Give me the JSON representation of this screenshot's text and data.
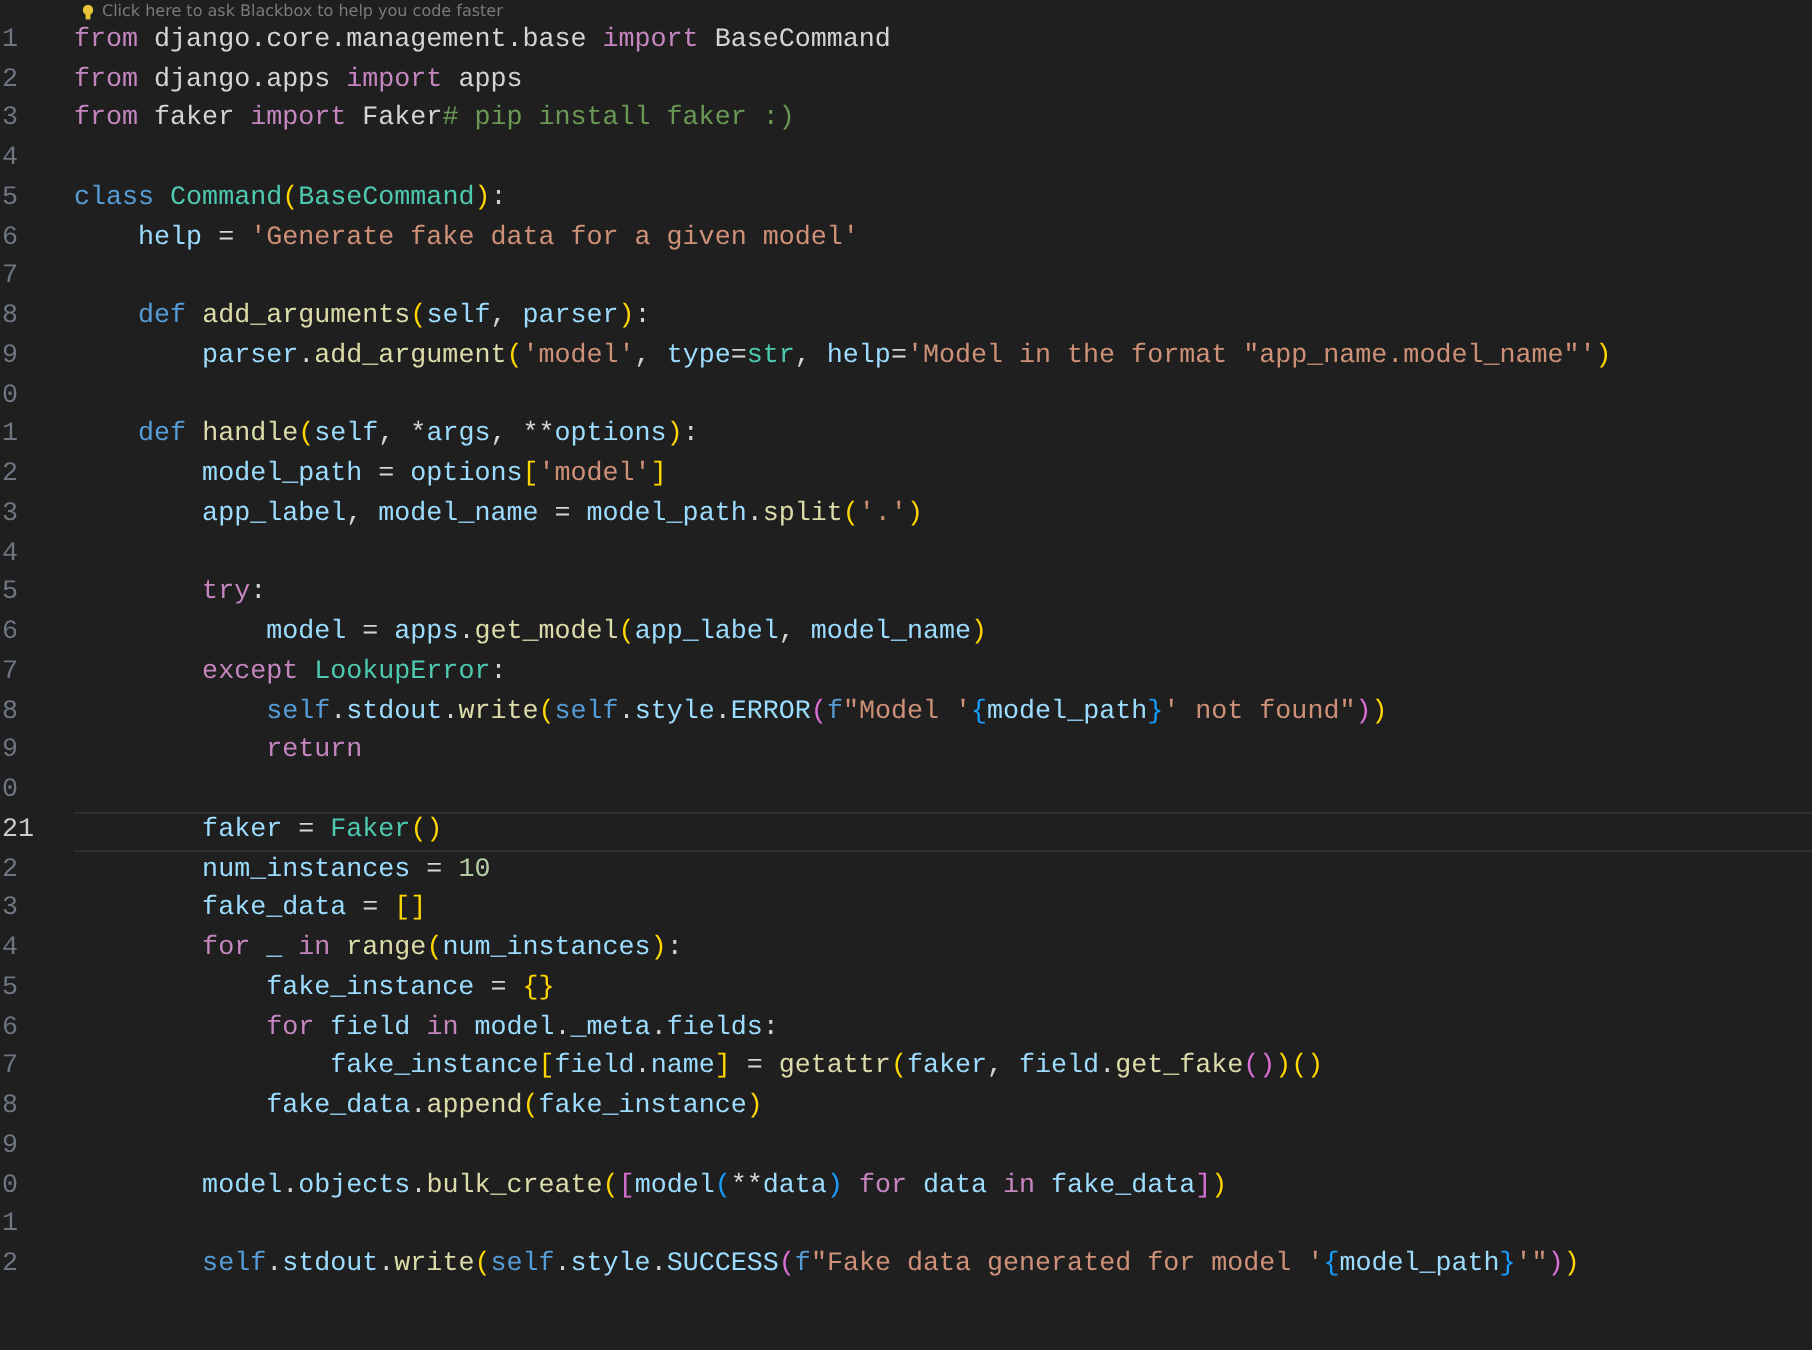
{
  "hint": {
    "text": "Click here to ask Blackbox to help you code faster"
  },
  "lines": [
    {
      "number": "1",
      "active": false,
      "tokens": [
        {
          "text": "from",
          "kind": "k"
        },
        {
          "text": " django.core.management.base ",
          "kind": "op"
        },
        {
          "text": "import",
          "kind": "k"
        },
        {
          "text": " BaseCommand",
          "kind": "op"
        }
      ]
    },
    {
      "number": "2",
      "active": false,
      "tokens": [
        {
          "text": "from",
          "kind": "k"
        },
        {
          "text": " django.apps ",
          "kind": "op"
        },
        {
          "text": "import",
          "kind": "k"
        },
        {
          "text": " apps",
          "kind": "op"
        }
      ]
    },
    {
      "number": "3",
      "active": false,
      "tokens": [
        {
          "text": "from",
          "kind": "k"
        },
        {
          "text": " faker ",
          "kind": "op"
        },
        {
          "text": "import",
          "kind": "k"
        },
        {
          "text": " Faker",
          "kind": "op"
        },
        {
          "text": "# pip install faker :)",
          "kind": "cm"
        }
      ]
    },
    {
      "number": "4",
      "active": false
    },
    {
      "number": "5",
      "active": false,
      "tokens": [
        {
          "text": "class ",
          "kind": "s"
        },
        {
          "text": "Command",
          "kind": "cls"
        },
        {
          "text": "(",
          "kind": "b1"
        },
        {
          "text": "BaseCommand",
          "kind": "cls"
        },
        {
          "text": ")",
          "kind": "b1"
        },
        {
          "text": ":",
          "kind": "op"
        }
      ]
    },
    {
      "number": "6",
      "active": false,
      "tokens": [
        {
          "text": "    help",
          "kind": "var"
        },
        {
          "text": " = ",
          "kind": "op"
        },
        {
          "text": "'Generate fake data for a given model'",
          "kind": "str"
        }
      ]
    },
    {
      "number": "7",
      "active": false
    },
    {
      "number": "8",
      "active": false,
      "tokens": [
        {
          "text": "    def ",
          "kind": "s"
        },
        {
          "text": "add_arguments",
          "kind": "fn"
        },
        {
          "text": "(",
          "kind": "b1"
        },
        {
          "text": "self",
          "kind": "var"
        },
        {
          "text": ", ",
          "kind": "op"
        },
        {
          "text": "parser",
          "kind": "var"
        },
        {
          "text": ")",
          "kind": "b1"
        },
        {
          "text": ":",
          "kind": "op"
        }
      ]
    },
    {
      "number": "9",
      "active": false,
      "tokens": [
        {
          "text": "        parser",
          "kind": "var"
        },
        {
          "text": ".",
          "kind": "op"
        },
        {
          "text": "add_argument",
          "kind": "fn"
        },
        {
          "text": "(",
          "kind": "b1"
        },
        {
          "text": "'model'",
          "kind": "str"
        },
        {
          "text": ", ",
          "kind": "op"
        },
        {
          "text": "type",
          "kind": "var"
        },
        {
          "text": "=",
          "kind": "op"
        },
        {
          "text": "str",
          "kind": "cls"
        },
        {
          "text": ", ",
          "kind": "op"
        },
        {
          "text": "help",
          "kind": "var"
        },
        {
          "text": "=",
          "kind": "op"
        },
        {
          "text": "'Model in the format \"app_name.model_name\"'",
          "kind": "str"
        },
        {
          "text": ")",
          "kind": "b1"
        }
      ]
    },
    {
      "number": "0",
      "active": false
    },
    {
      "number": "1",
      "active": false,
      "tokens": [
        {
          "text": "    def ",
          "kind": "s"
        },
        {
          "text": "handle",
          "kind": "fn"
        },
        {
          "text": "(",
          "kind": "b1"
        },
        {
          "text": "self",
          "kind": "var"
        },
        {
          "text": ", *",
          "kind": "op"
        },
        {
          "text": "args",
          "kind": "var"
        },
        {
          "text": ", **",
          "kind": "op"
        },
        {
          "text": "options",
          "kind": "var"
        },
        {
          "text": ")",
          "kind": "b1"
        },
        {
          "text": ":",
          "kind": "op"
        }
      ]
    },
    {
      "number": "2",
      "active": false,
      "tokens": [
        {
          "text": "        model_path",
          "kind": "var"
        },
        {
          "text": " = ",
          "kind": "op"
        },
        {
          "text": "options",
          "kind": "var"
        },
        {
          "text": "[",
          "kind": "b1"
        },
        {
          "text": "'model'",
          "kind": "str"
        },
        {
          "text": "]",
          "kind": "b1"
        }
      ]
    },
    {
      "number": "3",
      "active": false,
      "tokens": [
        {
          "text": "        app_label",
          "kind": "var"
        },
        {
          "text": ", ",
          "kind": "op"
        },
        {
          "text": "model_name",
          "kind": "var"
        },
        {
          "text": " = ",
          "kind": "op"
        },
        {
          "text": "model_path",
          "kind": "var"
        },
        {
          "text": ".",
          "kind": "op"
        },
        {
          "text": "split",
          "kind": "fn"
        },
        {
          "text": "(",
          "kind": "b1"
        },
        {
          "text": "'.'",
          "kind": "str"
        },
        {
          "text": ")",
          "kind": "b1"
        }
      ]
    },
    {
      "number": "4",
      "active": false
    },
    {
      "number": "5",
      "active": false,
      "tokens": [
        {
          "text": "        try",
          "kind": "k"
        },
        {
          "text": ":",
          "kind": "op"
        }
      ]
    },
    {
      "number": "6",
      "active": false,
      "tokens": [
        {
          "text": "            model",
          "kind": "var"
        },
        {
          "text": " = ",
          "kind": "op"
        },
        {
          "text": "apps",
          "kind": "var"
        },
        {
          "text": ".",
          "kind": "op"
        },
        {
          "text": "get_model",
          "kind": "fn"
        },
        {
          "text": "(",
          "kind": "b1"
        },
        {
          "text": "app_label",
          "kind": "var"
        },
        {
          "text": ", ",
          "kind": "op"
        },
        {
          "text": "model_name",
          "kind": "var"
        },
        {
          "text": ")",
          "kind": "b1"
        }
      ]
    },
    {
      "number": "7",
      "active": false,
      "tokens": [
        {
          "text": "        except ",
          "kind": "k"
        },
        {
          "text": "LookupError",
          "kind": "cls"
        },
        {
          "text": ":",
          "kind": "op"
        }
      ]
    },
    {
      "number": "8",
      "active": false,
      "tokens": [
        {
          "text": "            self",
          "kind": "s"
        },
        {
          "text": ".",
          "kind": "op"
        },
        {
          "text": "stdout",
          "kind": "var"
        },
        {
          "text": ".",
          "kind": "op"
        },
        {
          "text": "write",
          "kind": "fn"
        },
        {
          "text": "(",
          "kind": "b1"
        },
        {
          "text": "self",
          "kind": "s"
        },
        {
          "text": ".",
          "kind": "op"
        },
        {
          "text": "style",
          "kind": "var"
        },
        {
          "text": ".",
          "kind": "op"
        },
        {
          "text": "ERROR",
          "kind": "var"
        },
        {
          "text": "(",
          "kind": "b2"
        },
        {
          "text": "f",
          "kind": "s"
        },
        {
          "text": "\"Model '",
          "kind": "str"
        },
        {
          "text": "{",
          "kind": "b3"
        },
        {
          "text": "model_path",
          "kind": "var"
        },
        {
          "text": "}",
          "kind": "b3"
        },
        {
          "text": "' not found\"",
          "kind": "str"
        },
        {
          "text": ")",
          "kind": "b2"
        },
        {
          "text": ")",
          "kind": "b1"
        }
      ]
    },
    {
      "number": "9",
      "active": false,
      "tokens": [
        {
          "text": "            return",
          "kind": "k"
        }
      ]
    },
    {
      "number": "0",
      "active": false
    },
    {
      "number": "21",
      "active": true,
      "tokens": [
        {
          "text": "        faker",
          "kind": "var"
        },
        {
          "text": " = ",
          "kind": "op"
        },
        {
          "text": "Faker",
          "kind": "cls"
        },
        {
          "text": "()",
          "kind": "b1"
        }
      ]
    },
    {
      "number": "2",
      "active": false,
      "tokens": [
        {
          "text": "        num_instances",
          "kind": "var"
        },
        {
          "text": " = ",
          "kind": "op"
        },
        {
          "text": "10",
          "kind": "num"
        }
      ]
    },
    {
      "number": "3",
      "active": false,
      "tokens": [
        {
          "text": "        fake_data",
          "kind": "var"
        },
        {
          "text": " = ",
          "kind": "op"
        },
        {
          "text": "[]",
          "kind": "b1"
        }
      ]
    },
    {
      "number": "4",
      "active": false,
      "tokens": [
        {
          "text": "        for",
          "kind": "k"
        },
        {
          "text": " _ ",
          "kind": "var"
        },
        {
          "text": "in ",
          "kind": "k"
        },
        {
          "text": "range",
          "kind": "fn"
        },
        {
          "text": "(",
          "kind": "b1"
        },
        {
          "text": "num_instances",
          "kind": "var"
        },
        {
          "text": ")",
          "kind": "b1"
        },
        {
          "text": ":",
          "kind": "op"
        }
      ]
    },
    {
      "number": "5",
      "active": false,
      "tokens": [
        {
          "text": "            fake_instance",
          "kind": "var"
        },
        {
          "text": " = ",
          "kind": "op"
        },
        {
          "text": "{}",
          "kind": "b1"
        }
      ]
    },
    {
      "number": "6",
      "active": false,
      "tokens": [
        {
          "text": "            for",
          "kind": "k"
        },
        {
          "text": " field ",
          "kind": "var"
        },
        {
          "text": "in",
          "kind": "k"
        },
        {
          "text": " model",
          "kind": "var"
        },
        {
          "text": ".",
          "kind": "op"
        },
        {
          "text": "_meta",
          "kind": "var"
        },
        {
          "text": ".",
          "kind": "op"
        },
        {
          "text": "fields",
          "kind": "var"
        },
        {
          "text": ":",
          "kind": "op"
        }
      ]
    },
    {
      "number": "7",
      "active": false,
      "tokens": [
        {
          "text": "                fake_instance",
          "kind": "var"
        },
        {
          "text": "[",
          "kind": "b1"
        },
        {
          "text": "field",
          "kind": "var"
        },
        {
          "text": ".",
          "kind": "op"
        },
        {
          "text": "name",
          "kind": "var"
        },
        {
          "text": "]",
          "kind": "b1"
        },
        {
          "text": " = ",
          "kind": "op"
        },
        {
          "text": "getattr",
          "kind": "fn"
        },
        {
          "text": "(",
          "kind": "b1"
        },
        {
          "text": "faker",
          "kind": "var"
        },
        {
          "text": ", ",
          "kind": "op"
        },
        {
          "text": "field",
          "kind": "var"
        },
        {
          "text": ".",
          "kind": "op"
        },
        {
          "text": "get_fake",
          "kind": "fn"
        },
        {
          "text": "()",
          "kind": "b2"
        },
        {
          "text": ")()",
          "kind": "b1"
        }
      ]
    },
    {
      "number": "8",
      "active": false,
      "tokens": [
        {
          "text": "            fake_data",
          "kind": "var"
        },
        {
          "text": ".",
          "kind": "op"
        },
        {
          "text": "append",
          "kind": "fn"
        },
        {
          "text": "(",
          "kind": "b1"
        },
        {
          "text": "fake_instance",
          "kind": "var"
        },
        {
          "text": ")",
          "kind": "b1"
        }
      ]
    },
    {
      "number": "9",
      "active": false
    },
    {
      "number": "0",
      "active": false,
      "tokens": [
        {
          "text": "        model",
          "kind": "var"
        },
        {
          "text": ".",
          "kind": "op"
        },
        {
          "text": "objects",
          "kind": "var"
        },
        {
          "text": ".",
          "kind": "op"
        },
        {
          "text": "bulk_create",
          "kind": "fn"
        },
        {
          "text": "(",
          "kind": "b1"
        },
        {
          "text": "[",
          "kind": "b2"
        },
        {
          "text": "model",
          "kind": "var"
        },
        {
          "text": "(",
          "kind": "b3"
        },
        {
          "text": "**",
          "kind": "op"
        },
        {
          "text": "data",
          "kind": "var"
        },
        {
          "text": ")",
          "kind": "b3"
        },
        {
          "text": " for",
          "kind": "k"
        },
        {
          "text": " data ",
          "kind": "var"
        },
        {
          "text": "in",
          "kind": "k"
        },
        {
          "text": " fake_data",
          "kind": "var"
        },
        {
          "text": "]",
          "kind": "b2"
        },
        {
          "text": ")",
          "kind": "b1"
        }
      ]
    },
    {
      "number": "1",
      "active": false
    },
    {
      "number": "2",
      "active": false,
      "tokens": [
        {
          "text": "        self",
          "kind": "s"
        },
        {
          "text": ".",
          "kind": "op"
        },
        {
          "text": "stdout",
          "kind": "var"
        },
        {
          "text": ".",
          "kind": "op"
        },
        {
          "text": "write",
          "kind": "fn"
        },
        {
          "text": "(",
          "kind": "b1"
        },
        {
          "text": "self",
          "kind": "s"
        },
        {
          "text": ".",
          "kind": "op"
        },
        {
          "text": "style",
          "kind": "var"
        },
        {
          "text": ".",
          "kind": "op"
        },
        {
          "text": "SUCCESS",
          "kind": "var"
        },
        {
          "text": "(",
          "kind": "b2"
        },
        {
          "text": "f",
          "kind": "s"
        },
        {
          "text": "\"Fake data generated for model '",
          "kind": "str"
        },
        {
          "text": "{",
          "kind": "b3"
        },
        {
          "text": "model_path",
          "kind": "var"
        },
        {
          "text": "}",
          "kind": "b3"
        },
        {
          "text": "'\"",
          "kind": "str"
        },
        {
          "text": ")",
          "kind": "b2"
        },
        {
          "text": ")",
          "kind": "b1"
        }
      ]
    }
  ]
}
